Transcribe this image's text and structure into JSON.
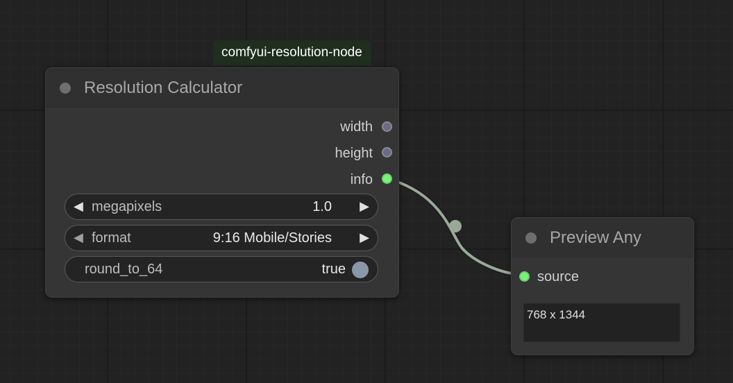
{
  "badge": {
    "text": "comfyui-resolution-node"
  },
  "resolution_node": {
    "title": "Resolution Calculator",
    "outputs": [
      "width",
      "height",
      "info"
    ],
    "widgets": {
      "megapixels": {
        "name": "megapixels",
        "value": "1.0",
        "left_arrow": "◀",
        "right_arrow": "▶"
      },
      "format": {
        "name": "format",
        "value": "9:16 Mobile/Stories",
        "left_arrow": "◀",
        "right_arrow": "▶"
      },
      "round_to_64": {
        "name": "round_to_64",
        "value": "true"
      }
    }
  },
  "preview_node": {
    "title": "Preview Any",
    "input": "source",
    "output_text": "768 x 1344"
  },
  "colors": {
    "canvas_bg": "#222222",
    "node_bg": "#353535",
    "badge_bg": "#1f2e1f",
    "link_color": "#9aa89a",
    "slot_green": "#7cf07c",
    "slot_default": "#6a6a8a"
  }
}
